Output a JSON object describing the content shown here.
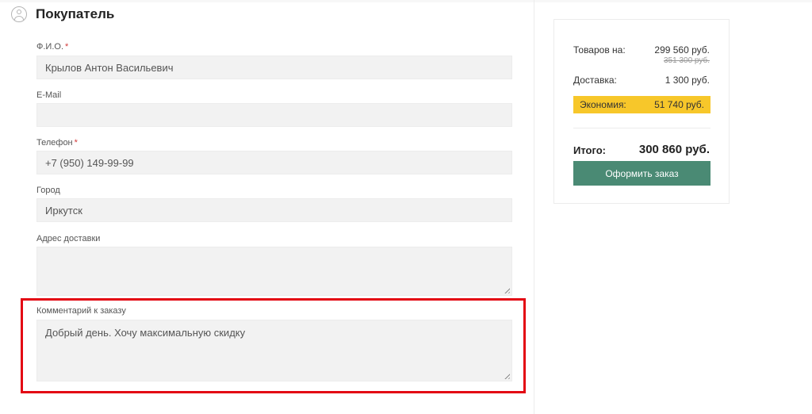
{
  "section": {
    "title": "Покупатель",
    "icon": "user-icon"
  },
  "form": {
    "fio": {
      "label": "Ф.И.О.",
      "required_mark": "*",
      "value": "Крылов Антон Васильевич"
    },
    "email": {
      "label": "E-Mail",
      "value": ""
    },
    "phone": {
      "label": "Телефон",
      "required_mark": "*",
      "value": "+7 (950) 149-99-99"
    },
    "city": {
      "label": "Город",
      "value": "Иркутск"
    },
    "address": {
      "label": "Адрес доставки",
      "value": ""
    },
    "comment": {
      "label": "Комментарий к заказу",
      "value": "Добрый день. Хочу максимальную скидку"
    }
  },
  "summary": {
    "goods_label": "Товаров на:",
    "goods_value": "299 560 руб.",
    "goods_old_value": "351 300 руб.",
    "delivery_label": "Доставка:",
    "delivery_value": "1 300 руб.",
    "economy_label": "Экономия:",
    "economy_value": "51 740 руб.",
    "total_label": "Итого:",
    "total_value": "300 860 руб.",
    "order_button": "Оформить заказ"
  },
  "colors": {
    "accent_button": "#4a8a74",
    "economy_highlight": "#f7c72a",
    "annotation_box": "#e30613",
    "required_mark": "#d23a3a"
  }
}
